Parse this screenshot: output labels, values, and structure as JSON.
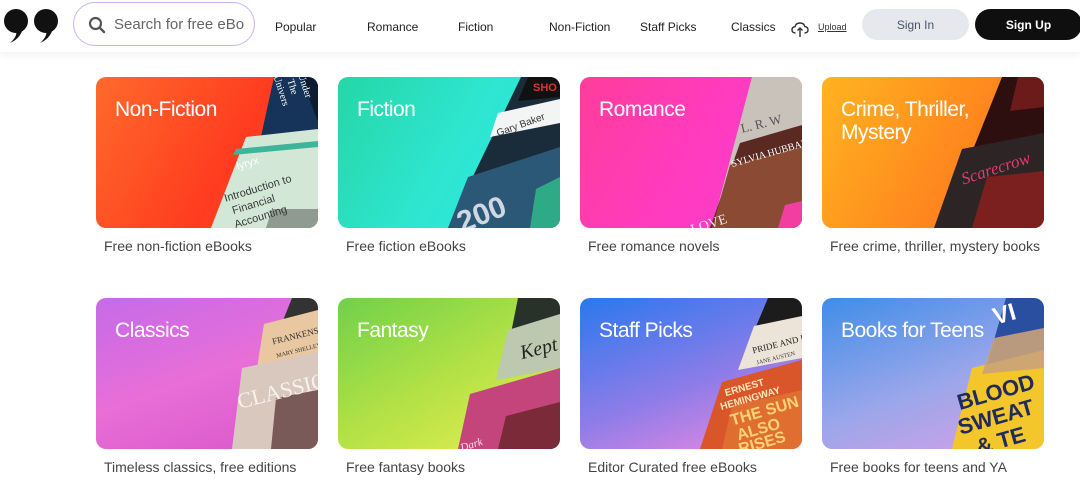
{
  "header": {
    "search_placeholder": "Search for free eBooks",
    "nav": [
      "Popular",
      "Romance",
      "Fiction",
      "Non-Fiction",
      "Staff Picks",
      "Classics"
    ],
    "upload_label": "Upload",
    "signin_label": "Sign In",
    "signup_label": "Sign Up"
  },
  "categories": [
    {
      "title": "Non-Fiction",
      "caption": "Free non-fiction eBooks",
      "cover_text": [
        "Under",
        "The",
        "Univers",
        "lyryx",
        "Introduction to",
        "Financial",
        "Accounting"
      ]
    },
    {
      "title": "Fiction",
      "caption": "Free fiction eBooks",
      "cover_text": [
        "Gary Baker",
        "200",
        "SHO"
      ]
    },
    {
      "title": "Romance",
      "caption": "Free romance novels",
      "cover_text": [
        "L. R. W",
        "SYLVIA HUBBARD",
        "LOVE"
      ]
    },
    {
      "title": "Crime, Thriller, Mystery",
      "caption": "Free crime, thriller, mystery books",
      "cover_text": [
        "Scarecrow"
      ]
    },
    {
      "title": "Classics",
      "caption": "Timeless classics, free editions",
      "cover_text": [
        "FRANKENSTE",
        "MARY SHELLEY",
        "CLASSIC"
      ]
    },
    {
      "title": "Fantasy",
      "caption": "Free fantasy books",
      "cover_text": [
        "Kept",
        "Dark"
      ]
    },
    {
      "title": "Staff Picks",
      "caption": "Editor Curated free eBooks",
      "cover_text": [
        "PRIDE AND PREJU",
        "JANE AUSTEN",
        "ERNEST",
        "HEMINGWAY",
        "THE SUN",
        "ALSO",
        "RISES"
      ]
    },
    {
      "title": "Books for Teens",
      "caption": "Free books for teens and YA",
      "cover_text": [
        "VI",
        "BLOOD",
        "SWEAT",
        "& TE"
      ]
    }
  ]
}
